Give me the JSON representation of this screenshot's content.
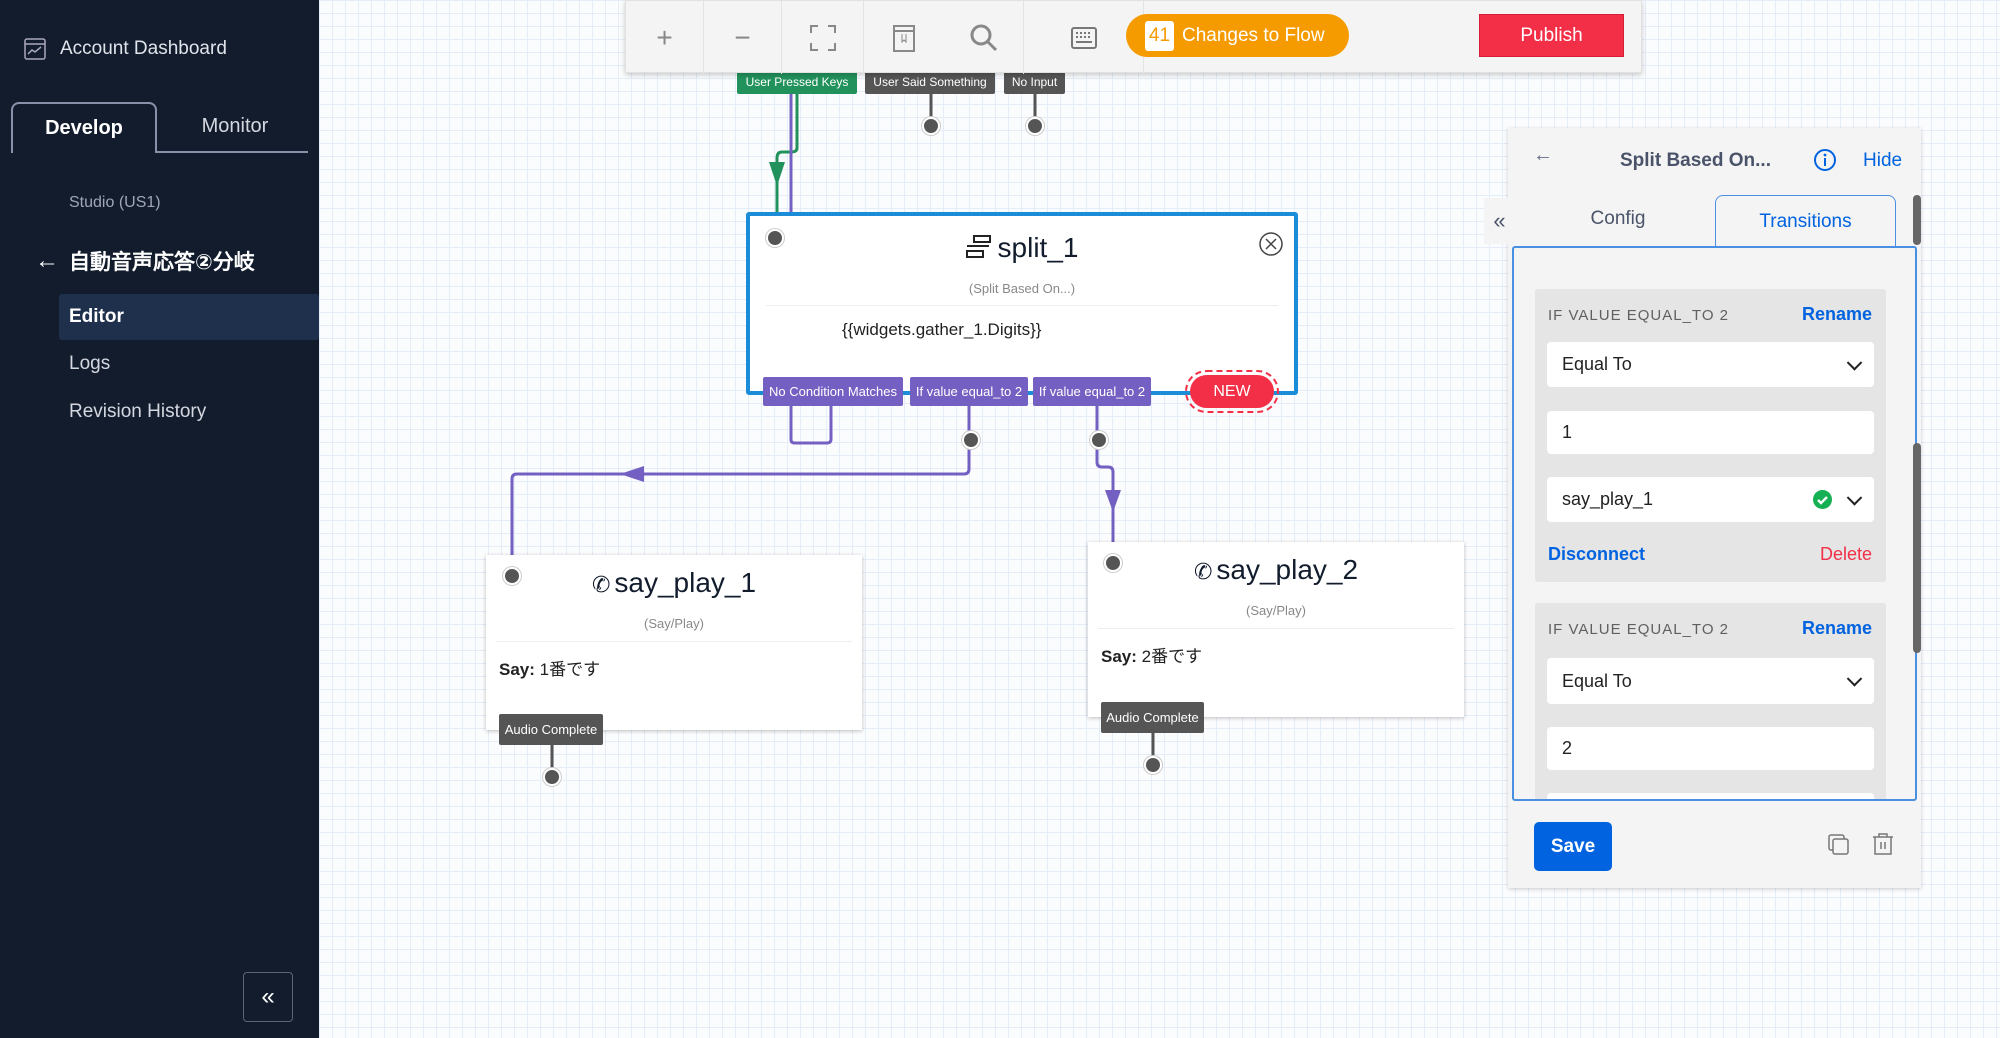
{
  "sidebar": {
    "account_dashboard": "Account Dashboard",
    "tabs": [
      {
        "label": "Develop",
        "active": true
      },
      {
        "label": "Monitor",
        "active": false
      }
    ],
    "region": "Studio (US1)",
    "flow_title": "自動音声応答②分岐",
    "nav": [
      {
        "label": "Editor",
        "active": true
      },
      {
        "label": "Logs"
      },
      {
        "label": "Revision History"
      }
    ],
    "collapse_icon": "double-chevron-left"
  },
  "toolbar": {
    "zoom_in": "+",
    "zoom_out": "−",
    "changes_count": "41",
    "changes_label": "Changes to Flow",
    "publish": "Publish",
    "colors": {
      "changes": "#f59b00",
      "publish": "#f22f46"
    }
  },
  "trigger": {
    "transitions": [
      "User Pressed Keys",
      "User Said Something",
      "No Input"
    ]
  },
  "split": {
    "name": "split_1",
    "type": "(Split Based On...)",
    "expression": "{{widgets.gather_1.Digits}}",
    "transitions": [
      "No Condition Matches",
      "If value equal_to 2",
      "If value equal_to 2"
    ],
    "new_label": "NEW"
  },
  "say_play_1": {
    "name": "say_play_1",
    "type": "(Say/Play)",
    "say_label": "Say:",
    "say_value": "1番です",
    "transition": "Audio Complete"
  },
  "say_play_2": {
    "name": "say_play_2",
    "type": "(Say/Play)",
    "say_label": "Say:",
    "say_value": "2番です",
    "transition": "Audio Complete"
  },
  "panel": {
    "title": "Split Based On...",
    "hide": "Hide",
    "tabs": [
      {
        "label": "Config",
        "active": false
      },
      {
        "label": "Transitions",
        "active": true
      }
    ],
    "conditions": [
      {
        "label": "IF VALUE EQUAL_TO 2",
        "rename": "Rename",
        "operator": "Equal To",
        "value": "1",
        "target": "say_play_1",
        "disconnect": "Disconnect",
        "delete": "Delete"
      },
      {
        "label": "IF VALUE EQUAL_TO 2",
        "rename": "Rename",
        "operator": "Equal To",
        "value": "2"
      }
    ],
    "save": "Save"
  }
}
